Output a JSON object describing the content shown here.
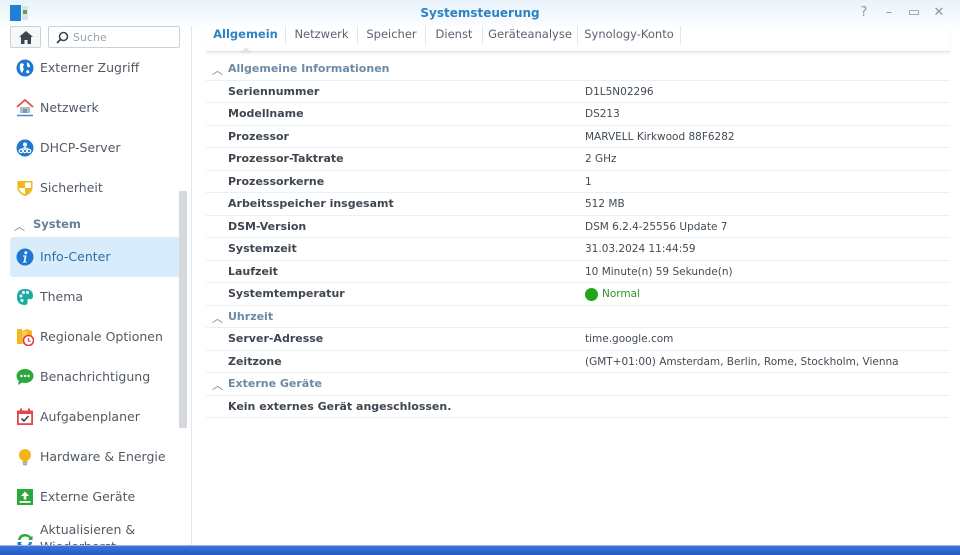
{
  "window": {
    "title": "Systemsteuerung",
    "controls": [
      {
        "name": "help",
        "glyph": "?"
      },
      {
        "name": "minimize",
        "glyph": "–"
      },
      {
        "name": "maximize",
        "glyph": "▭"
      },
      {
        "name": "close",
        "glyph": "✕"
      }
    ]
  },
  "sidebar": {
    "search_placeholder": "Suche",
    "items": [
      {
        "label": "Externer Zugriff",
        "icon": "globe-icon"
      },
      {
        "label": "Netzwerk",
        "icon": "network-house-icon"
      },
      {
        "label": "DHCP-Server",
        "icon": "dhcp-icon"
      },
      {
        "label": "Sicherheit",
        "icon": "shield-icon"
      }
    ],
    "group": {
      "label": "System",
      "expanded": true
    },
    "system_items": [
      {
        "label": "Info-Center",
        "icon": "info-icon",
        "active": true
      },
      {
        "label": "Thema",
        "icon": "palette-icon"
      },
      {
        "label": "Regionale Optionen",
        "icon": "regional-clock-icon"
      },
      {
        "label": "Benachrichtigung",
        "icon": "chat-bubble-icon"
      },
      {
        "label": "Aufgabenplaner",
        "icon": "calendar-check-icon"
      },
      {
        "label": "Hardware & Energie",
        "icon": "lightbulb-icon"
      },
      {
        "label": "Externe Geräte",
        "icon": "upload-icon"
      },
      {
        "label": "Aktualisieren &\nWiederherst...",
        "icon": "refresh-icon"
      }
    ]
  },
  "tabs": [
    {
      "label": "Allgemein",
      "active": true
    },
    {
      "label": "Netzwerk"
    },
    {
      "label": "Speicher"
    },
    {
      "label": "Dienst"
    },
    {
      "label": "Geräteanalyse"
    },
    {
      "label": "Synology-Konto"
    }
  ],
  "sections": {
    "general": {
      "title": "Allgemeine Informationen",
      "rows": [
        {
          "key": "Seriennummer",
          "value": "D1L5N02296"
        },
        {
          "key": "Modellname",
          "value": "DS213"
        },
        {
          "key": "Prozessor",
          "value": "MARVELL Kirkwood 88F6282"
        },
        {
          "key": "Prozessor-Taktrate",
          "value": "2 GHz"
        },
        {
          "key": "Prozessorkerne",
          "value": "1"
        },
        {
          "key": "Arbeitsspeicher insgesamt",
          "value": "512 MB"
        },
        {
          "key": "DSM-Version",
          "value": "DSM 6.2.4-25556 Update 7"
        },
        {
          "key": "Systemzeit",
          "value": "31.03.2024 11:44:59"
        },
        {
          "key": "Laufzeit",
          "value": "10 Minute(n) 59 Sekunde(n)"
        },
        {
          "key": "Systemtemperatur",
          "value": "Normal",
          "status": "ok",
          "status_color": "#1fa51a"
        }
      ]
    },
    "time": {
      "title": "Uhrzeit",
      "rows": [
        {
          "key": "Server-Adresse",
          "value": "time.google.com"
        },
        {
          "key": "Zeitzone",
          "value": "(GMT+01:00) Amsterdam, Berlin, Rome, Stockholm, Vienna"
        }
      ]
    },
    "external": {
      "title": "Externe Geräte",
      "message": "Kein externes Gerät angeschlossen."
    }
  },
  "colors": {
    "accent": "#2d83c4",
    "active_nav_bg": "#d9ecfb",
    "status_ok": "#1fa51a",
    "taskbar": "#2b62cf"
  }
}
